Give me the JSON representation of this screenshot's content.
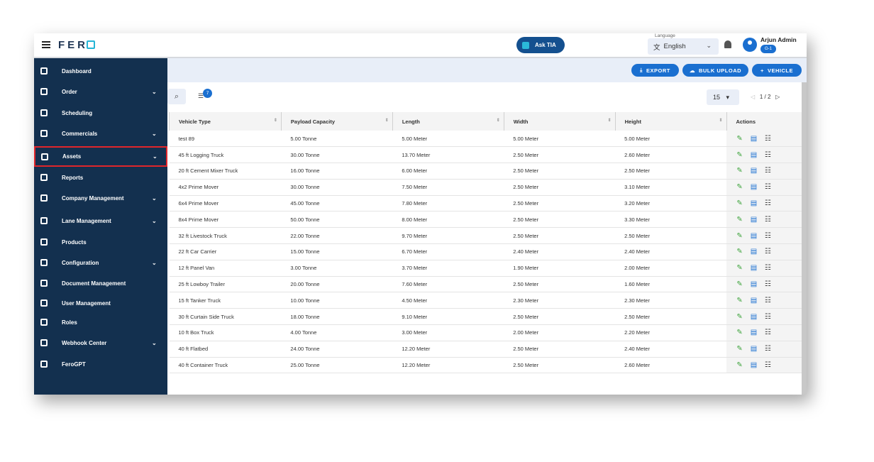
{
  "header": {
    "brand": "FER",
    "ask_tia": "Ask TIA",
    "language_label": "Language",
    "language": "English",
    "user_name": "Arjun Admin",
    "user_badge": "G-1"
  },
  "sidebar": {
    "items": [
      {
        "label": "Dashboard",
        "expand": false
      },
      {
        "label": "Order",
        "expand": true
      },
      {
        "label": "Scheduling",
        "expand": false
      },
      {
        "label": "Commercials",
        "expand": true
      },
      {
        "label": "Assets",
        "expand": true,
        "selected": true
      },
      {
        "label": "Reports",
        "expand": false
      },
      {
        "label": "Company Management",
        "expand": true
      },
      {
        "label": "Lane Management",
        "expand": true
      },
      {
        "label": "Products",
        "expand": false
      },
      {
        "label": "Configuration",
        "expand": true
      },
      {
        "label": "Document Management",
        "expand": false
      },
      {
        "label": "User Management",
        "expand": false
      },
      {
        "label": "Roles",
        "expand": false
      },
      {
        "label": "Webhook Center",
        "expand": true
      },
      {
        "label": "FeroGPT",
        "expand": false
      }
    ]
  },
  "toolbar": {
    "export": "EXPORT",
    "bulk_upload": "BULK UPLOAD",
    "add_vehicle": "VEHICLE",
    "filter_count": "7",
    "per_page": "15",
    "page": "1 / 2"
  },
  "table": {
    "columns": [
      "Vehicle Type",
      "Payload Capacity",
      "Length",
      "Width",
      "Height",
      "Actions"
    ],
    "rows": [
      [
        "test 89",
        "5.00 Tonne",
        "5.00 Meter",
        "5.00 Meter",
        "5.00 Meter"
      ],
      [
        "45 ft Logging Truck",
        "30.00 Tonne",
        "13.70 Meter",
        "2.50 Meter",
        "2.60 Meter"
      ],
      [
        "20 ft Cement Mixer Truck",
        "16.00 Tonne",
        "6.00 Meter",
        "2.50 Meter",
        "2.50 Meter"
      ],
      [
        "4x2 Prime Mover",
        "30.00 Tonne",
        "7.50 Meter",
        "2.50 Meter",
        "3.10 Meter"
      ],
      [
        "6x4 Prime Mover",
        "45.00 Tonne",
        "7.80 Meter",
        "2.50 Meter",
        "3.20 Meter"
      ],
      [
        "8x4 Prime Mover",
        "50.00 Tonne",
        "8.00 Meter",
        "2.50 Meter",
        "3.30 Meter"
      ],
      [
        "32 ft Livestock Truck",
        "22.00 Tonne",
        "9.70 Meter",
        "2.50 Meter",
        "2.50 Meter"
      ],
      [
        "22 ft Car Carrier",
        "15.00 Tonne",
        "6.70 Meter",
        "2.40 Meter",
        "2.40 Meter"
      ],
      [
        "12 ft Panel Van",
        "3.00 Tonne",
        "3.70 Meter",
        "1.90 Meter",
        "2.00 Meter"
      ],
      [
        "25 ft Lowboy Trailer",
        "20.00 Tonne",
        "7.60 Meter",
        "2.50 Meter",
        "1.60 Meter"
      ],
      [
        "15 ft Tanker Truck",
        "10.00 Tonne",
        "4.50 Meter",
        "2.30 Meter",
        "2.30 Meter"
      ],
      [
        "30 ft Curtain Side Truck",
        "18.00 Tonne",
        "9.10 Meter",
        "2.50 Meter",
        "2.50 Meter"
      ],
      [
        "10 ft Box Truck",
        "4.00 Tonne",
        "3.00 Meter",
        "2.00 Meter",
        "2.20 Meter"
      ],
      [
        "40 ft Flatbed",
        "24.00 Tonne",
        "12.20 Meter",
        "2.50 Meter",
        "2.40 Meter"
      ],
      [
        "40 ft Container Truck",
        "25.00 Tonne",
        "12.20 Meter",
        "2.50 Meter",
        "2.60 Meter"
      ]
    ]
  },
  "colors": {
    "sidebar": "#13304f",
    "primary": "#1a6fd0",
    "edit": "#3da33b",
    "highlight": "#e0262b"
  }
}
